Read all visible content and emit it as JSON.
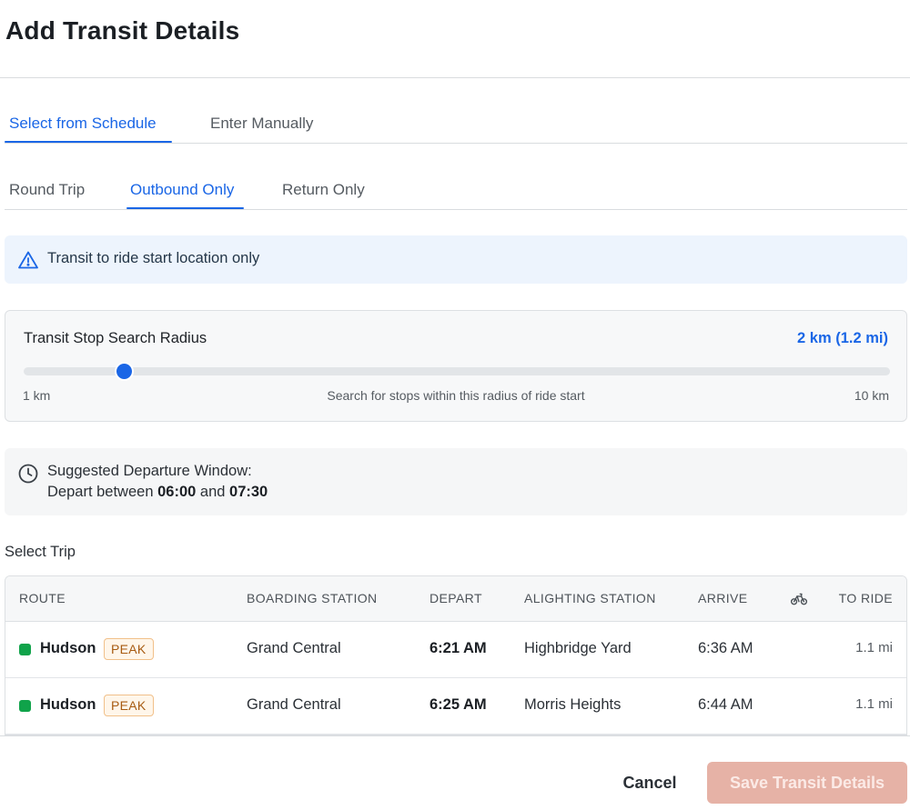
{
  "modal": {
    "title": "Add Transit Details"
  },
  "source_tabs": {
    "items": [
      {
        "label": "Select from Schedule",
        "active": true
      },
      {
        "label": "Enter Manually",
        "active": false
      }
    ]
  },
  "trip_type_tabs": {
    "items": [
      {
        "label": "Round Trip",
        "active": false
      },
      {
        "label": "Outbound Only",
        "active": true
      },
      {
        "label": "Return Only",
        "active": false
      }
    ]
  },
  "info_banner": {
    "icon": "warning-triangle-icon",
    "text": "Transit to ride start location only"
  },
  "radius": {
    "label": "Transit Stop Search Radius",
    "value_text": "2 km (1.2 mi)",
    "value_km": 2,
    "min_label": "1 km",
    "max_label": "10 km",
    "min_km": 1,
    "max_km": 10,
    "hint": "Search for stops within this radius of ride start"
  },
  "departure": {
    "icon": "clock-icon",
    "title": "Suggested Departure Window:",
    "prefix": "Depart between",
    "start": "06:00",
    "joiner": "and",
    "end": "07:30"
  },
  "select_trip": {
    "label": "Select Trip"
  },
  "trips_table": {
    "headers": {
      "route": "ROUTE",
      "boarding": "BOARDING STATION",
      "depart": "DEPART",
      "alighting": "ALIGHTING STATION",
      "arrive": "ARRIVE",
      "bike_icon": "bicycle-icon",
      "to_ride": "TO RIDE"
    },
    "rows": [
      {
        "route": "Hudson",
        "route_color": "#10a34a",
        "badge": "PEAK",
        "boarding": "Grand Central",
        "depart": "6:21 AM",
        "alighting": "Highbridge Yard",
        "arrive": "6:36 AM",
        "to_ride": "1.1 mi"
      },
      {
        "route": "Hudson",
        "route_color": "#10a34a",
        "badge": "PEAK",
        "boarding": "Grand Central",
        "depart": "6:25 AM",
        "alighting": "Morris Heights",
        "arrive": "6:44 AM",
        "to_ride": "1.1 mi"
      }
    ]
  },
  "footer": {
    "cancel_label": "Cancel",
    "save_label": "Save Transit Details"
  },
  "colors": {
    "accent": "#1a66e6",
    "route_green": "#10a34a",
    "save_disabled": "#e6b2a6"
  }
}
